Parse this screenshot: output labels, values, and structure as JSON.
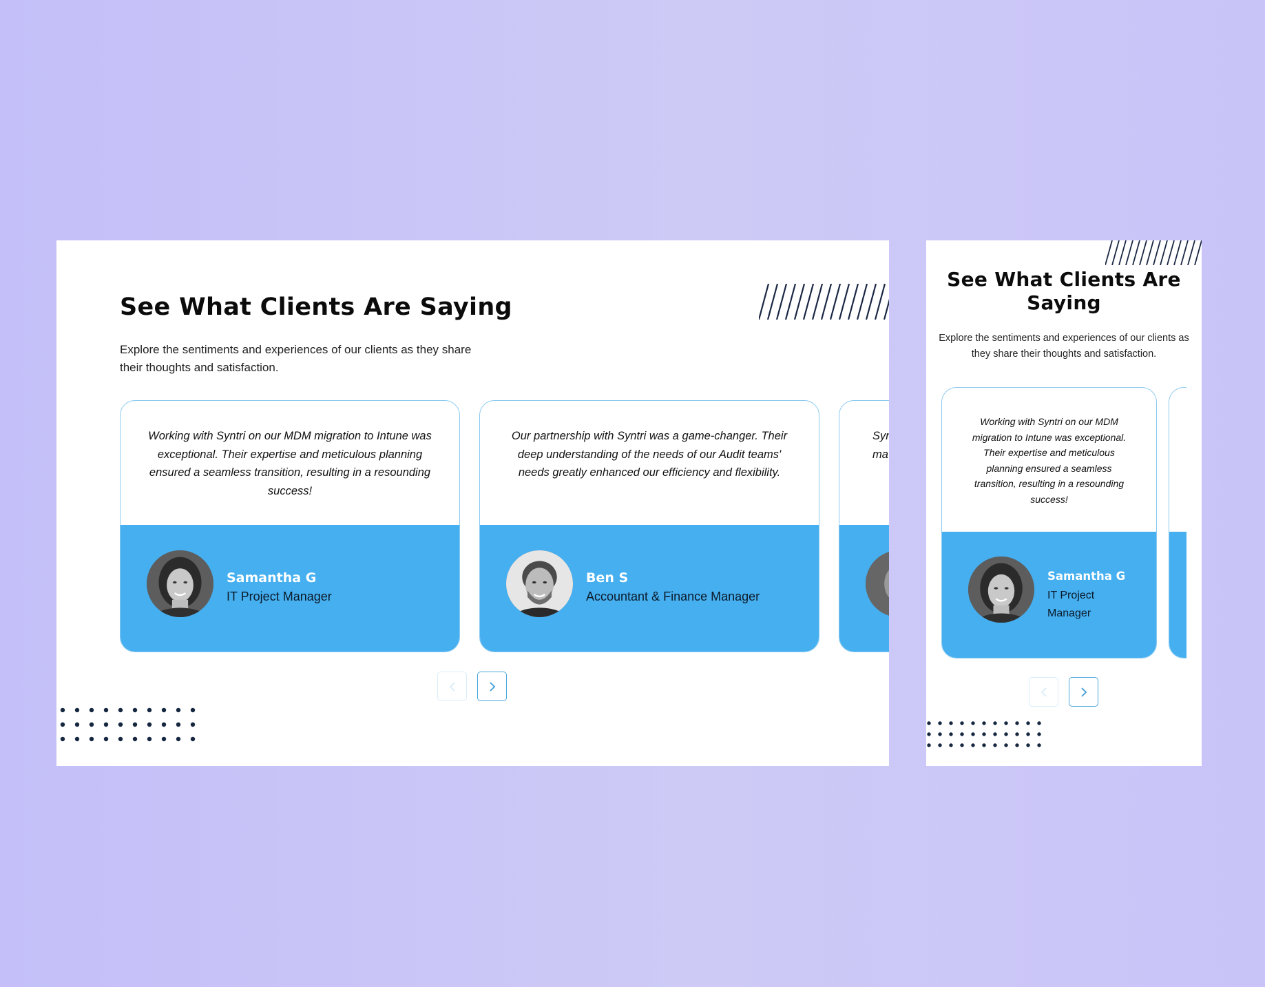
{
  "section": {
    "heading": "See What Clients Are Saying",
    "subheading": "Explore the sentiments and experiences of our clients as they share their thoughts and satisfaction."
  },
  "testimonials": [
    {
      "quote": "Working with Syntri on our MDM migration to Intune was exceptional. Their expertise and meticulous planning ensured a seamless transition, resulting in a resounding success!",
      "name": "Samantha G",
      "role": "IT Project Manager"
    },
    {
      "quote": "Our partnership with Syntri was a game-changer. Their deep understanding of the needs of our Audit teams' needs greatly enhanced our efficiency and flexibility.",
      "name": "Ben S",
      "role": "Accountant & Finance Manager"
    },
    {
      "quote_fragment_line1": "Syn",
      "quote_fragment_line2": "ma"
    }
  ],
  "navigation": {
    "prev_icon": "chevron-left-icon",
    "next_icon": "chevron-right-icon"
  },
  "colors": {
    "page_background": "#c6c1f8",
    "panel_background": "#ffffff",
    "card_footer": "#45aff0",
    "card_border": "#8ac9f0",
    "heading_text": "#0b0b0b",
    "decor_navy": "#1a2744",
    "nav_active_border": "#4aa7dd"
  }
}
